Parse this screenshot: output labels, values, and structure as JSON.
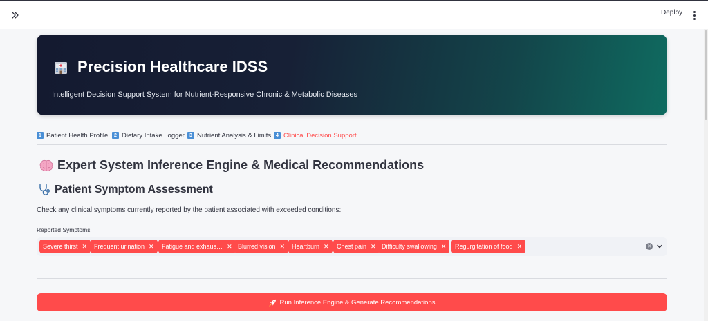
{
  "topbar": {
    "deploy_label": "Deploy"
  },
  "hero": {
    "title": "Precision Healthcare IDSS",
    "subtitle": "Intelligent Decision Support System for Nutrient-Responsive Chronic & Metabolic Diseases",
    "icon": "hospital-icon",
    "gradient_colors": [
      "#141a30",
      "#0f6b60"
    ]
  },
  "tabs": [
    {
      "num": "1",
      "label": "Patient Health Profile"
    },
    {
      "num": "2",
      "label": "Dietary Intake Logger"
    },
    {
      "num": "3",
      "label": "Nutrient Analysis & Limits"
    },
    {
      "num": "4",
      "label": "Clinical Decision Support"
    }
  ],
  "active_tab": "Clinical Decision Support",
  "section": {
    "expert_heading": "Expert System Inference Engine & Medical Recommendations",
    "expert_icon": "brain-icon",
    "symptom_heading": "Patient Symptom Assessment",
    "symptom_icon": "stethoscope-icon",
    "description": "Check any clinical symptoms currently reported by the patient associated with exceeded conditions:",
    "field_label": "Reported Symptoms"
  },
  "symptoms": [
    "Severe thirst",
    "Frequent urination",
    "Fatigue and exhaus…",
    "Blurred vision",
    "Heartburn",
    "Chest pain",
    "Difficulty swallowing",
    "Regurgitation of food"
  ],
  "run_button": {
    "label": "Run Inference Engine & Generate Recommendations",
    "icon": "rocket-icon"
  },
  "colors": {
    "accent": "#ff4b4b",
    "text": "#31333f",
    "background": "#f6f7f9",
    "tab_number": "#4a8fd6"
  }
}
